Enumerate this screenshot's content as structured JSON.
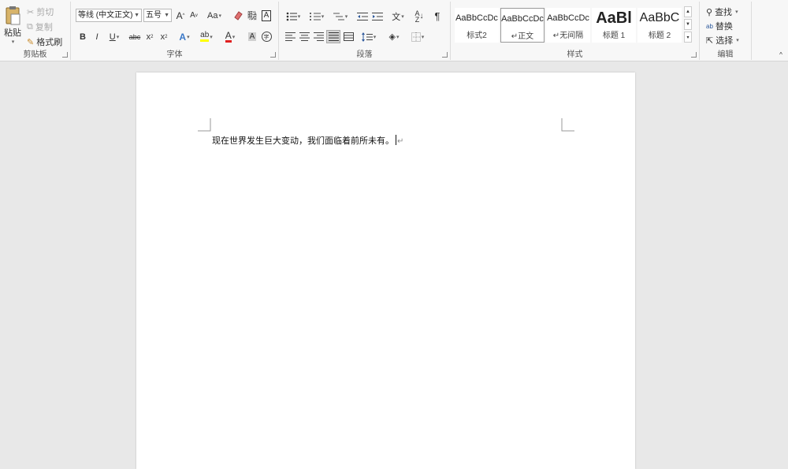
{
  "ribbon": {
    "clipboard": {
      "paste_label": "粘贴",
      "cut_label": "剪切",
      "copy_label": "复制",
      "format_painter_label": "格式刷",
      "group_label": "剪贴板"
    },
    "font": {
      "font_name": "等线 (中文正文)",
      "font_size": "五号",
      "grow_label": "A",
      "shrink_label": "A",
      "case_label": "Aa",
      "bold": "B",
      "italic": "I",
      "underline": "U",
      "strike": "abc",
      "subscript": "x",
      "superscript": "x",
      "highlight_label": "ab",
      "font_color_label": "A",
      "char_shading_label": "A",
      "enclose_label": "字",
      "group_label": "字体"
    },
    "paragraph": {
      "group_label": "段落"
    },
    "styles": {
      "items": [
        {
          "preview": "AaBbCcDc",
          "name": "标式2"
        },
        {
          "preview": "AaBbCcDc",
          "name": "正文"
        },
        {
          "preview": "AaBbCcDc",
          "name": "无间隔"
        },
        {
          "preview": "AaBl",
          "name": "标题 1"
        },
        {
          "preview": "AaBbC",
          "name": "标题 2"
        }
      ],
      "group_label": "样式"
    },
    "editing": {
      "find_label": "查找",
      "replace_label": "替换",
      "select_label": "选择",
      "group_label": "编辑"
    }
  },
  "document": {
    "text": "现在世界发生巨大变动，我们面临着前所未有。"
  },
  "colors": {
    "accent": "#2b579a",
    "highlight": "#ffff00",
    "font_color": "#e02020"
  }
}
